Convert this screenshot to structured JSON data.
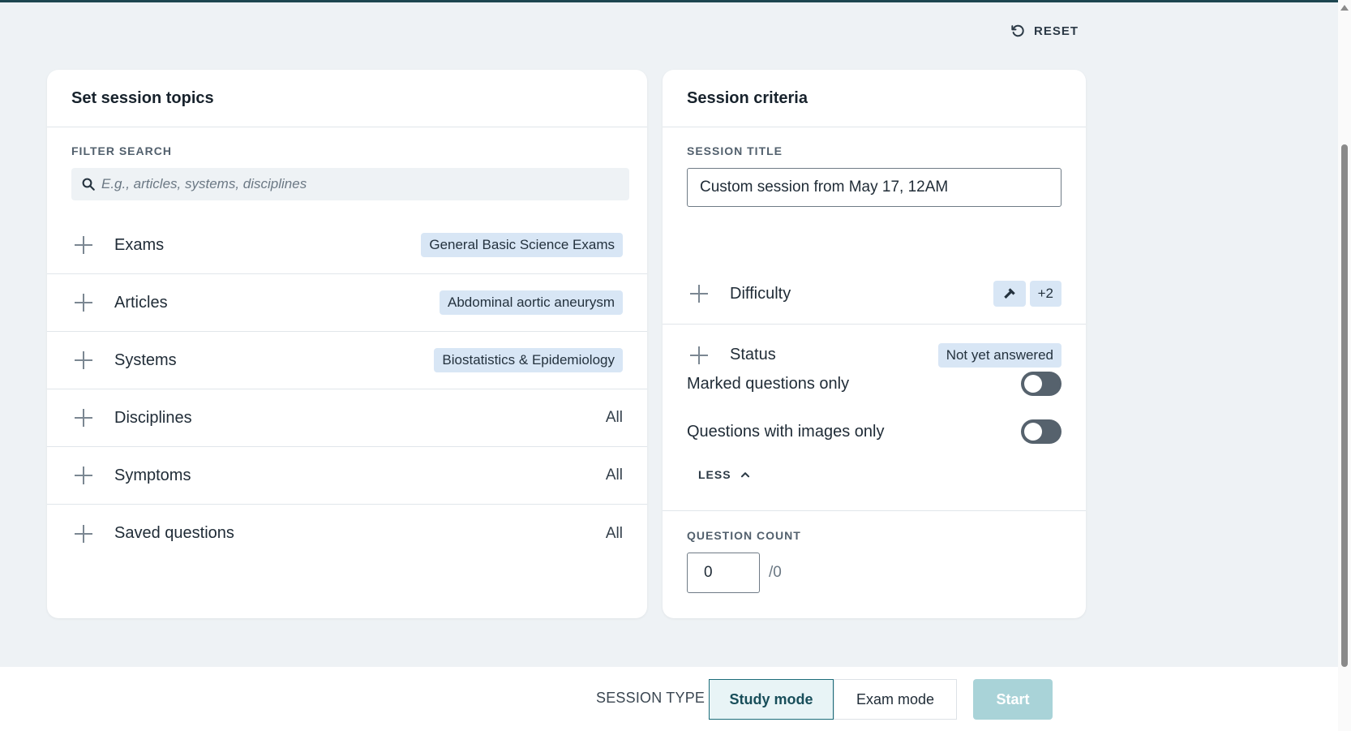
{
  "header": {
    "reset_label": "RESET"
  },
  "topics_card": {
    "title": "Set session topics",
    "filter_label": "FILTER SEARCH",
    "search_placeholder": "E.g., articles, systems, disciplines",
    "rows": [
      {
        "label": "Exams",
        "value": "General Basic Science Exams",
        "chip": true
      },
      {
        "label": "Articles",
        "value": "Abdominal aortic aneurysm",
        "chip": true
      },
      {
        "label": "Systems",
        "value": "Biostatistics & Epidemiology",
        "chip": true
      },
      {
        "label": "Disciplines",
        "value": "All",
        "chip": false
      },
      {
        "label": "Symptoms",
        "value": "All",
        "chip": false
      },
      {
        "label": "Saved questions",
        "value": "All",
        "chip": false
      }
    ]
  },
  "criteria_card": {
    "title": "Session criteria",
    "session_title_label": "SESSION TITLE",
    "session_title_value": "Custom session from May 17, 12AM",
    "difficulty": {
      "label": "Difficulty",
      "icon": "hammer-icon",
      "extra_count": "+2"
    },
    "status": {
      "label": "Status",
      "value": "Not yet answered"
    },
    "marked_only": {
      "label": "Marked questions only",
      "enabled": false
    },
    "images_only": {
      "label": "Questions with images only",
      "enabled": false
    },
    "less_label": "LESS",
    "question_count_label": "QUESTION COUNT",
    "question_count_value": "0",
    "question_count_total": "/0"
  },
  "footer": {
    "session_type_label": "SESSION TYPE",
    "study_mode_label": "Study mode",
    "exam_mode_label": "Exam mode",
    "selected_mode": "Study mode",
    "start_label": "Start"
  },
  "colors": {
    "accent": "#1d6d7a",
    "chip_bg": "#d8e6f5",
    "start_disabled": "#a9d3d8",
    "page_bg": "#eef2f5"
  }
}
